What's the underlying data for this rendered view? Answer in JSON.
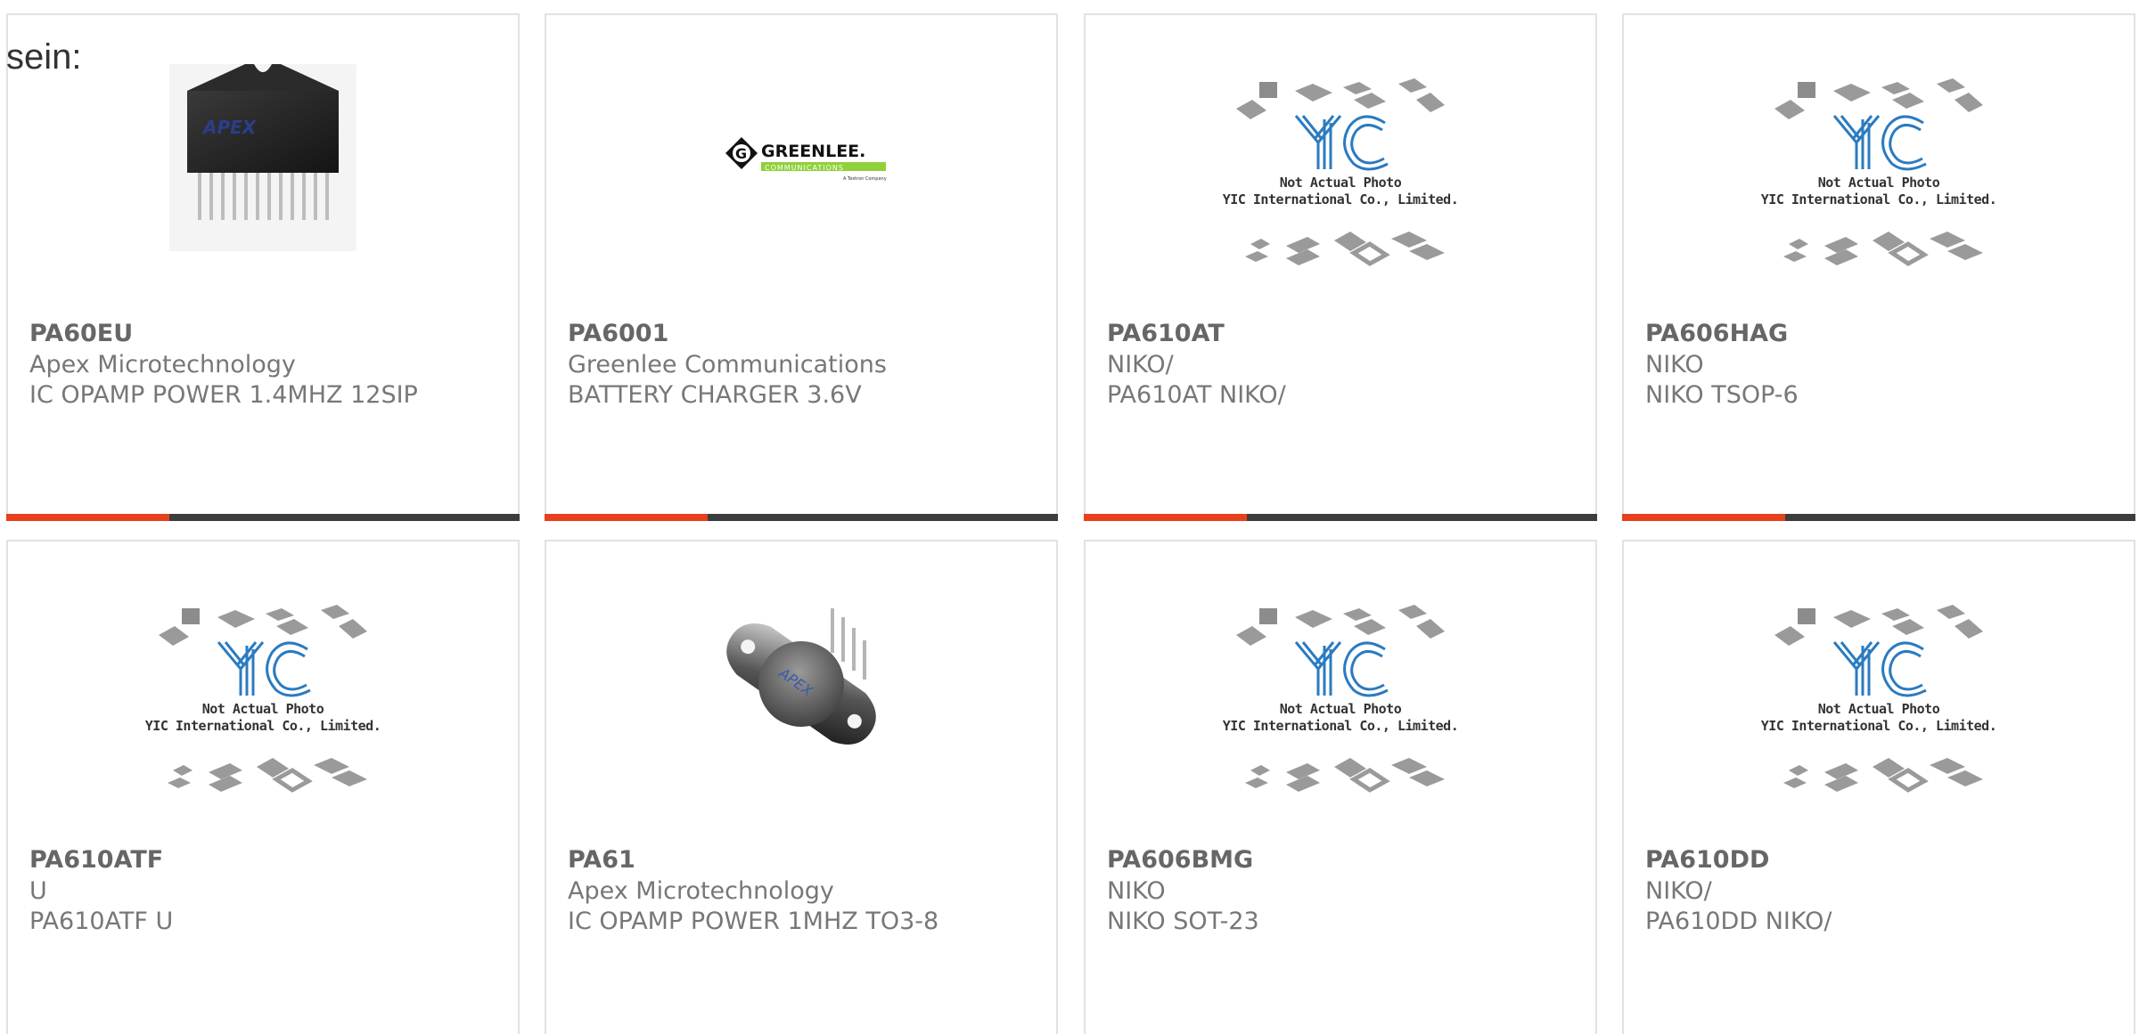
{
  "page": {
    "heading": "sein:"
  },
  "colors": {
    "accent": "#e8401c",
    "bar": "#3d3d3d",
    "title": "#666666",
    "text": "#777777"
  },
  "placeholder": {
    "line1": "Not Actual Photo",
    "line2": "YIC International Co., Limited.",
    "logo": "YIC"
  },
  "brands": {
    "greenlee_name": "GREENLEE.",
    "greenlee_sub": "COMMUNICATIONS",
    "greenlee_tag": "A Textron Company",
    "apex": "APEX"
  },
  "products": [
    {
      "part": "PA60EU",
      "maker": "Apex Microtechnology",
      "desc": "IC OPAMP POWER 1.4MHZ 12SIP",
      "image": "sip-chip-photo"
    },
    {
      "part": "PA6001",
      "maker": "Greenlee Communications",
      "desc": "BATTERY CHARGER 3.6V",
      "image": "greenlee-logo"
    },
    {
      "part": "PA610AT",
      "maker": "NIKO/",
      "desc": "PA610AT NIKO/",
      "image": "yic-placeholder"
    },
    {
      "part": "PA606HAG",
      "maker": "NIKO",
      "desc": "NIKO TSOP-6",
      "image": "yic-placeholder"
    },
    {
      "part": "PA610ATF",
      "maker": "U",
      "desc": "PA610ATF U",
      "image": "yic-placeholder"
    },
    {
      "part": "PA61",
      "maker": "Apex Microtechnology",
      "desc": "IC OPAMP POWER 1MHZ TO3-8",
      "image": "to3-package-photo"
    },
    {
      "part": "PA606BMG",
      "maker": "NIKO",
      "desc": "NIKO SOT-23",
      "image": "yic-placeholder"
    },
    {
      "part": "PA610DD",
      "maker": "NIKO/",
      "desc": "PA610DD NIKO/",
      "image": "yic-placeholder"
    }
  ]
}
